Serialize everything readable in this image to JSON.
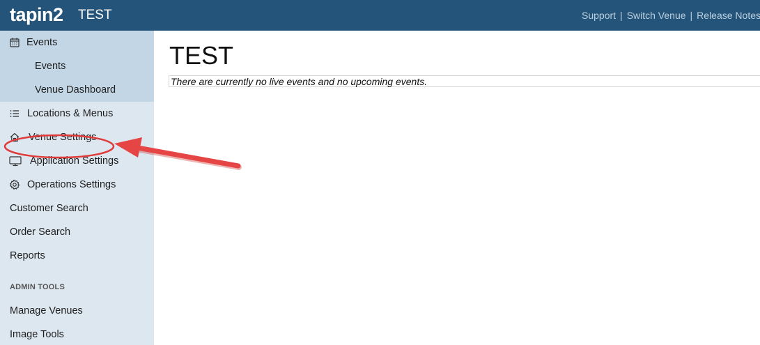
{
  "header": {
    "logo": "tapin2",
    "venue": "TEST",
    "links": [
      "Support",
      "Switch Venue",
      "Release Notes"
    ]
  },
  "sidebar": {
    "events_group": {
      "title": "Events",
      "items": [
        "Events",
        "Venue Dashboard"
      ]
    },
    "items": [
      {
        "label": "Locations & Menus",
        "icon": "list-icon"
      },
      {
        "label": "Venue Settings",
        "icon": "home-icon"
      },
      {
        "label": "Application Settings",
        "icon": "monitor-icon"
      },
      {
        "label": "Operations Settings",
        "icon": "gear-icon"
      },
      {
        "label": "Customer Search"
      },
      {
        "label": "Order Search"
      },
      {
        "label": "Reports"
      }
    ],
    "admin_heading": "ADMIN TOOLS",
    "admin_items": [
      "Manage Venues",
      "Image Tools"
    ]
  },
  "main": {
    "title": "TEST",
    "notice": "There are currently no live events and no upcoming events."
  },
  "colors": {
    "header_bg": "#245479",
    "sidebar_bg": "#dde7f0",
    "sidebar_active_bg": "#c3d6e5",
    "annotation_red": "#e03a3a"
  }
}
